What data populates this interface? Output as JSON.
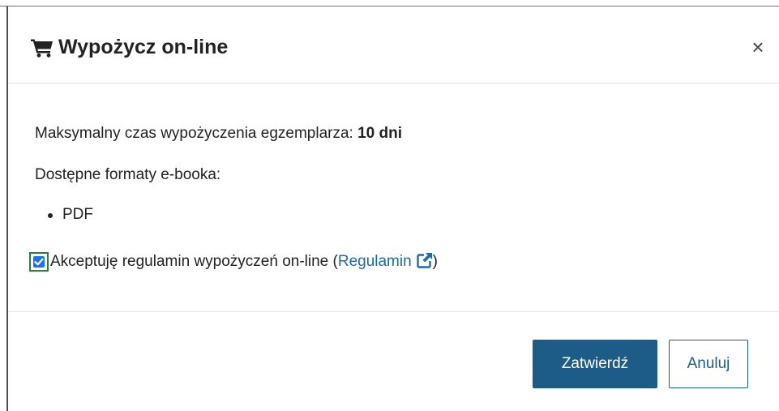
{
  "dialog": {
    "title": "Wypożycz on-line",
    "title_icon": "shopping-cart-icon",
    "close_label": "×",
    "close_icon": "close-icon"
  },
  "body": {
    "max_time_label": "Maksymalny czas wypożyczenia egzemplarza:",
    "max_time_value": "10 dni",
    "formats_label": "Dostępne formaty e-booka:",
    "formats": [
      "PDF"
    ],
    "accept": {
      "checked": true,
      "text_before": "Akceptuję regulamin wypożyczeń on-line (",
      "link_label": "Regulamin",
      "link_icon": "external-link-icon",
      "text_after": ")"
    }
  },
  "footer": {
    "confirm_label": "Zatwierdź",
    "cancel_label": "Anuluj"
  },
  "colors": {
    "primary": "#1d5c86",
    "link": "#1f6aa5",
    "checkbox": "#1a73e8",
    "checkbox_focus": "#2e7d32"
  }
}
